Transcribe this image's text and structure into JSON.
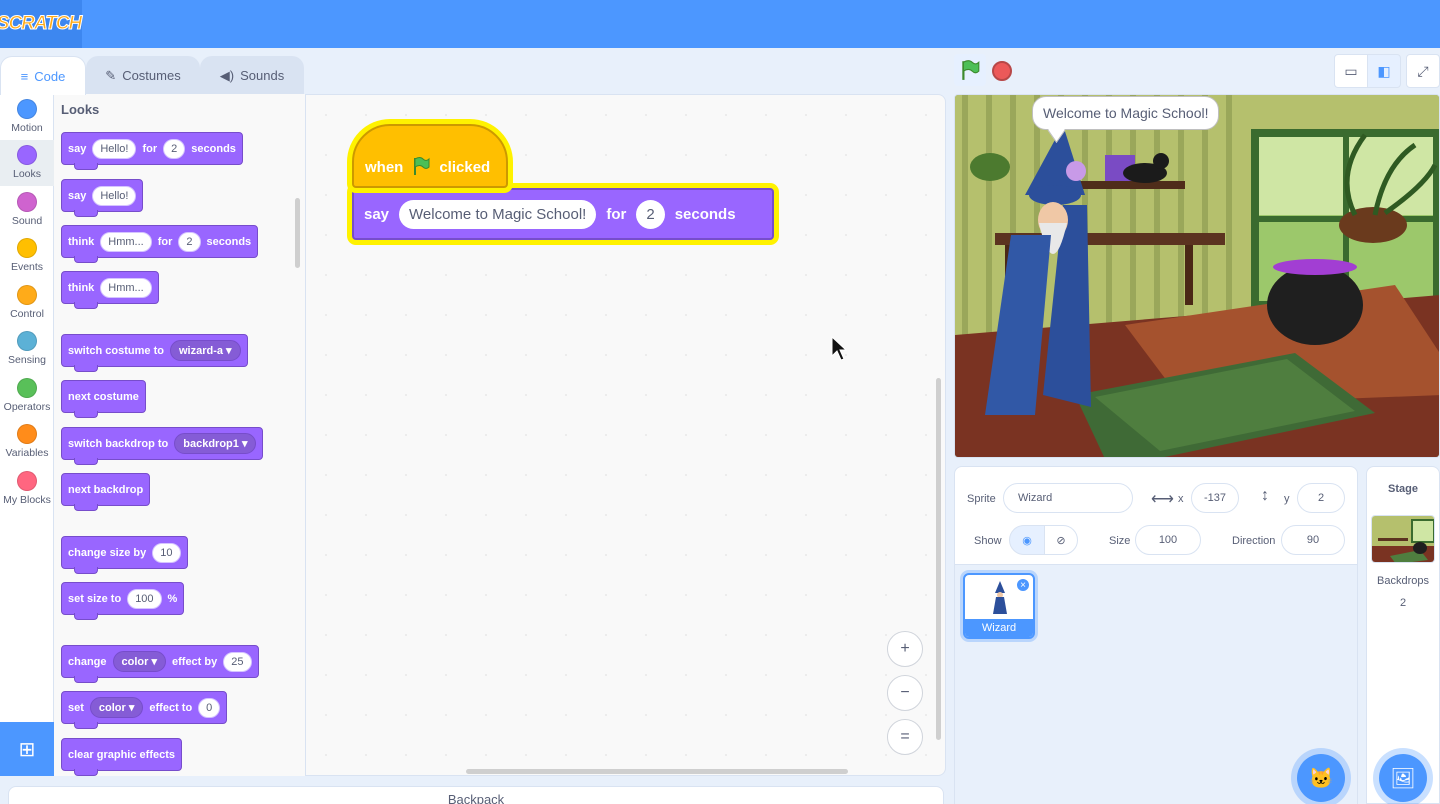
{
  "app": {
    "logo": "SCRATCH"
  },
  "tabs": [
    {
      "label": "Code",
      "icon": "code-icon"
    },
    {
      "label": "Costumes",
      "icon": "brush-icon"
    },
    {
      "label": "Sounds",
      "icon": "speaker-icon"
    }
  ],
  "categories": [
    {
      "label": "Motion",
      "color": "#4c97ff"
    },
    {
      "label": "Looks",
      "color": "#9966ff"
    },
    {
      "label": "Sound",
      "color": "#cf63cf"
    },
    {
      "label": "Events",
      "color": "#ffbf00"
    },
    {
      "label": "Control",
      "color": "#ffab19"
    },
    {
      "label": "Sensing",
      "color": "#5cb1d6"
    },
    {
      "label": "Operators",
      "color": "#59c059"
    },
    {
      "label": "Variables",
      "color": "#ff8c1a"
    },
    {
      "label": "My Blocks",
      "color": "#ff6680"
    }
  ],
  "flyout": {
    "title": "Looks",
    "blocks": {
      "say_for": {
        "w1": "say",
        "v1": "Hello!",
        "w2": "for",
        "v2": "2",
        "w3": "seconds"
      },
      "say": {
        "w1": "say",
        "v1": "Hello!"
      },
      "think_for": {
        "w1": "think",
        "v1": "Hmm...",
        "w2": "for",
        "v2": "2",
        "w3": "seconds"
      },
      "think": {
        "w1": "think",
        "v1": "Hmm..."
      },
      "switch_costume": {
        "w1": "switch costume to",
        "v1": "wizard-a"
      },
      "next_costume": {
        "w1": "next costume"
      },
      "switch_backdrop": {
        "w1": "switch backdrop to",
        "v1": "backdrop1"
      },
      "next_backdrop": {
        "w1": "next backdrop"
      },
      "change_size": {
        "w1": "change size by",
        "v1": "10"
      },
      "set_size": {
        "w1": "set size to",
        "v1": "100",
        "w2": "%"
      },
      "change_effect": {
        "w1": "change",
        "v1": "color",
        "w2": "effect by",
        "v2": "25"
      },
      "set_effect": {
        "w1": "set",
        "v1": "color",
        "w2": "effect to",
        "v2": "0"
      },
      "clear_effects": {
        "w1": "clear graphic effects"
      }
    }
  },
  "script": {
    "hat": {
      "w1": "when",
      "w2": "clicked"
    },
    "say": {
      "w1": "say",
      "v1": "Welcome to Magic School!",
      "w2": "for",
      "v2": "2",
      "w3": "seconds"
    }
  },
  "zoom": {
    "in": "+",
    "out": "−",
    "reset": "="
  },
  "backpack": {
    "label": "Backpack"
  },
  "stage": {
    "speech": "Welcome to Magic School!"
  },
  "sprite_info": {
    "sprite_label": "Sprite",
    "sprite_name": "Wizard",
    "x_label": "x",
    "x_value": "-137",
    "y_label": "y",
    "y_value": "2",
    "show_label": "Show",
    "size_label": "Size",
    "size_value": "100",
    "direction_label": "Direction",
    "direction_value": "90"
  },
  "sprites": [
    {
      "name": "Wizard"
    }
  ],
  "stage_selector": {
    "title": "Stage",
    "backdrops_label": "Backdrops",
    "backdrops_count": "2"
  }
}
